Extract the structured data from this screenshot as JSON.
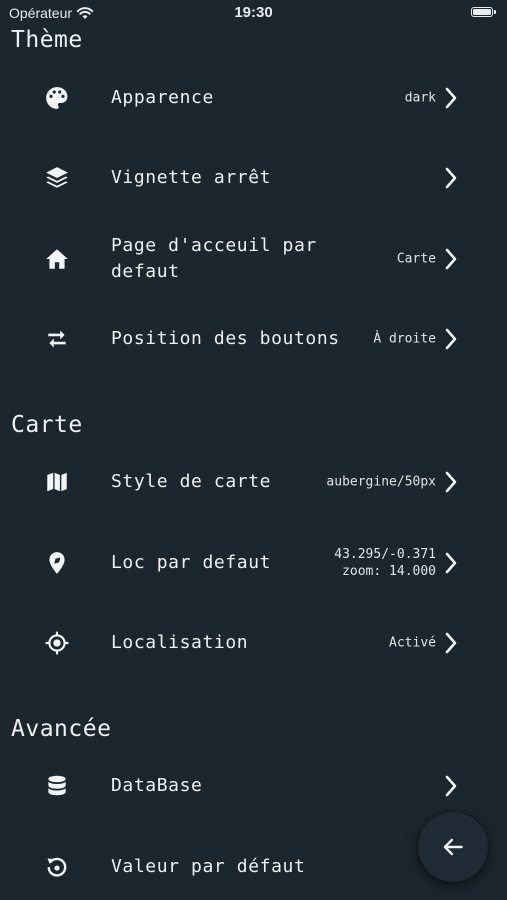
{
  "status_bar": {
    "carrier": "Opérateur",
    "time": "19:30"
  },
  "sections": {
    "theme": {
      "title": "Thème",
      "apparence": {
        "label": "Apparence",
        "value": "dark",
        "icon": "palette-icon"
      },
      "vignette": {
        "label": "Vignette arrêt",
        "value": "",
        "icon": "layers-icon"
      },
      "accueil": {
        "label": "Page d'acceuil par defaut",
        "value": "Carte",
        "icon": "home-icon"
      },
      "boutons": {
        "label": "Position des boutons",
        "value": "À droite",
        "icon": "swap-arrows-icon"
      }
    },
    "carte": {
      "title": "Carte",
      "style": {
        "label": "Style de carte",
        "value": "aubergine/50px",
        "icon": "map-icon"
      },
      "loc": {
        "label": "Loc par defaut",
        "value_line1": "43.295/-0.371",
        "value_line2": "zoom: 14.000",
        "icon": "location-compass-icon"
      },
      "localisation": {
        "label": "Localisation",
        "value": "Activé",
        "icon": "gps-target-icon"
      }
    },
    "avancee": {
      "title": "Avancée",
      "database": {
        "label": "DataBase",
        "value": "",
        "icon": "database-icon"
      },
      "defaut": {
        "label": "Valeur par défaut",
        "value": "",
        "icon": "restore-icon"
      }
    }
  },
  "fab": {
    "icon": "arrow-left-icon"
  },
  "colors": {
    "background": "#1c262f",
    "text": "#eef0f2",
    "fab": "#1f2a34"
  }
}
